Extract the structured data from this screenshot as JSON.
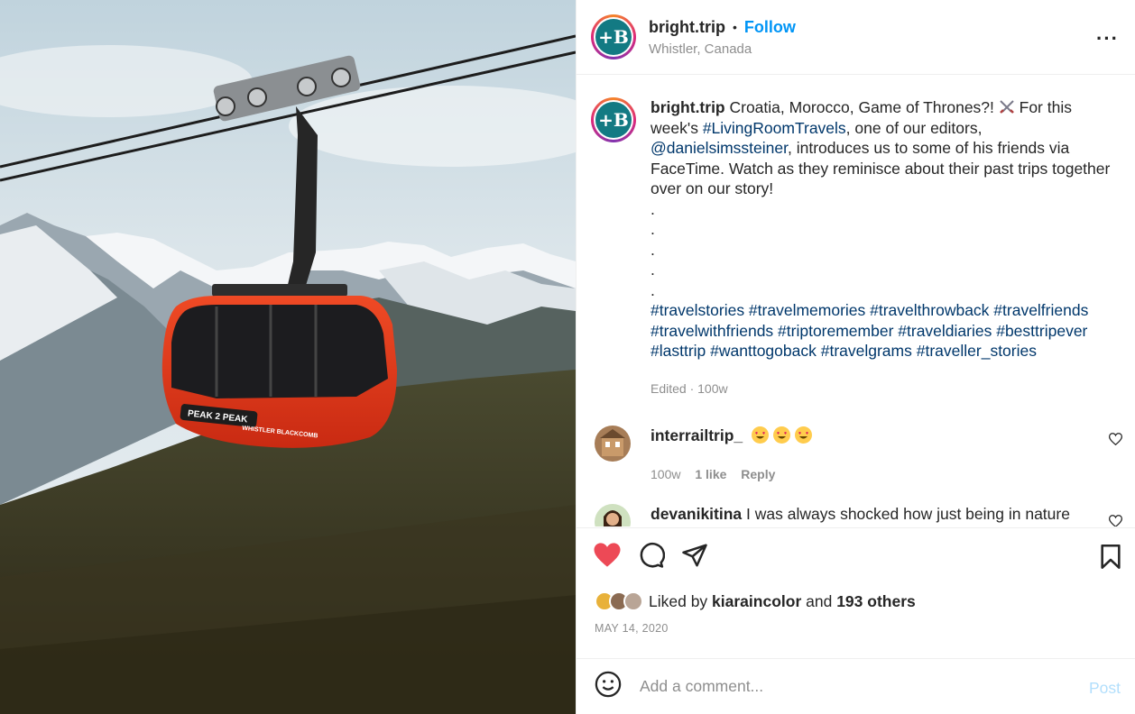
{
  "post": {
    "username": "bright.trip",
    "dot": "•",
    "follow_label": "Follow",
    "location": "Whistler, Canada",
    "more_label": "···",
    "avatar_letter": "+B"
  },
  "media": {
    "gondola_text1": "PEAK 2 PEAK",
    "gondola_text2": "WHISTLER BLACKCOMB"
  },
  "caption": {
    "username": "bright.trip",
    "text1": " Croatia, Morocco, Game of Thrones?! ",
    "text2": " For this week's ",
    "tag1": "#LivingRoomTravels",
    "text3": ", one of our editors, ",
    "mention": "@danielsimssteiner",
    "text4": ", introduces us to some of his friends via FaceTime. Watch as they reminisce about their past trips together over on our story!",
    "dots": [
      ".",
      ".",
      ".",
      ".",
      "."
    ],
    "hashtags_line1": "#travelstories #travelmemories #travelthrowback #travelfriends",
    "hashtags_line2": "#travelwithfriends #triptoremember #traveldiaries #besttripever",
    "hashtags_line3": "#lasttrip #wanttogoback #travelgrams #traveller_stories",
    "edited": "Edited · 100w"
  },
  "comments": [
    {
      "username": "interrailtrip_",
      "text": "",
      "time": "100w",
      "likes": "1 like",
      "reply": "Reply"
    },
    {
      "username": "devanikitina",
      "text": " I was always shocked how just being in nature enjoying sun or fresh forest makes you feel so rich and so"
    }
  ],
  "likes": {
    "prefix": "Liked by ",
    "user": "kiaraincolor",
    "mid": " and ",
    "others": "193 others"
  },
  "date": "MAY 14, 2020",
  "add_comment": {
    "placeholder": "Add a comment...",
    "post_label": "Post"
  },
  "colors": {
    "link": "#00376b",
    "follow": "#0095f6",
    "heart": "#ed4956",
    "post_disabled": "#b2dffc",
    "gondola": "#e23a1d"
  }
}
